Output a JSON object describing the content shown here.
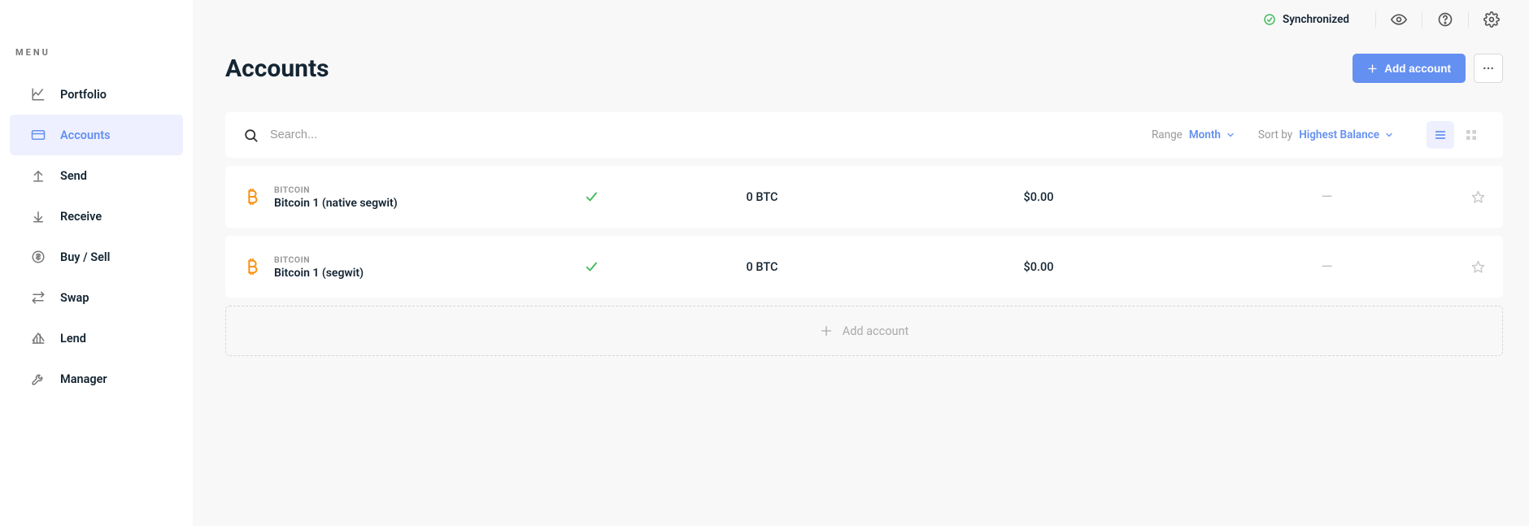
{
  "sidebar": {
    "header": "MENU",
    "items": [
      {
        "label": "Portfolio"
      },
      {
        "label": "Accounts"
      },
      {
        "label": "Send"
      },
      {
        "label": "Receive"
      },
      {
        "label": "Buy / Sell"
      },
      {
        "label": "Swap"
      },
      {
        "label": "Lend"
      },
      {
        "label": "Manager"
      }
    ]
  },
  "topbar": {
    "sync_label": "Synchronized"
  },
  "page": {
    "title": "Accounts",
    "add_button": "Add account"
  },
  "filter": {
    "search_placeholder": "Search...",
    "range_label": "Range",
    "range_value": "Month",
    "sort_label": "Sort by",
    "sort_value": "Highest Balance"
  },
  "accounts": [
    {
      "kind": "BITCOIN",
      "name": "Bitcoin 1 (native segwit)",
      "balance": "0 BTC",
      "value": "$0.00",
      "trend": "—"
    },
    {
      "kind": "BITCOIN",
      "name": "Bitcoin 1 (segwit)",
      "balance": "0 BTC",
      "value": "$0.00",
      "trend": "—"
    }
  ],
  "add_row_label": "Add account"
}
